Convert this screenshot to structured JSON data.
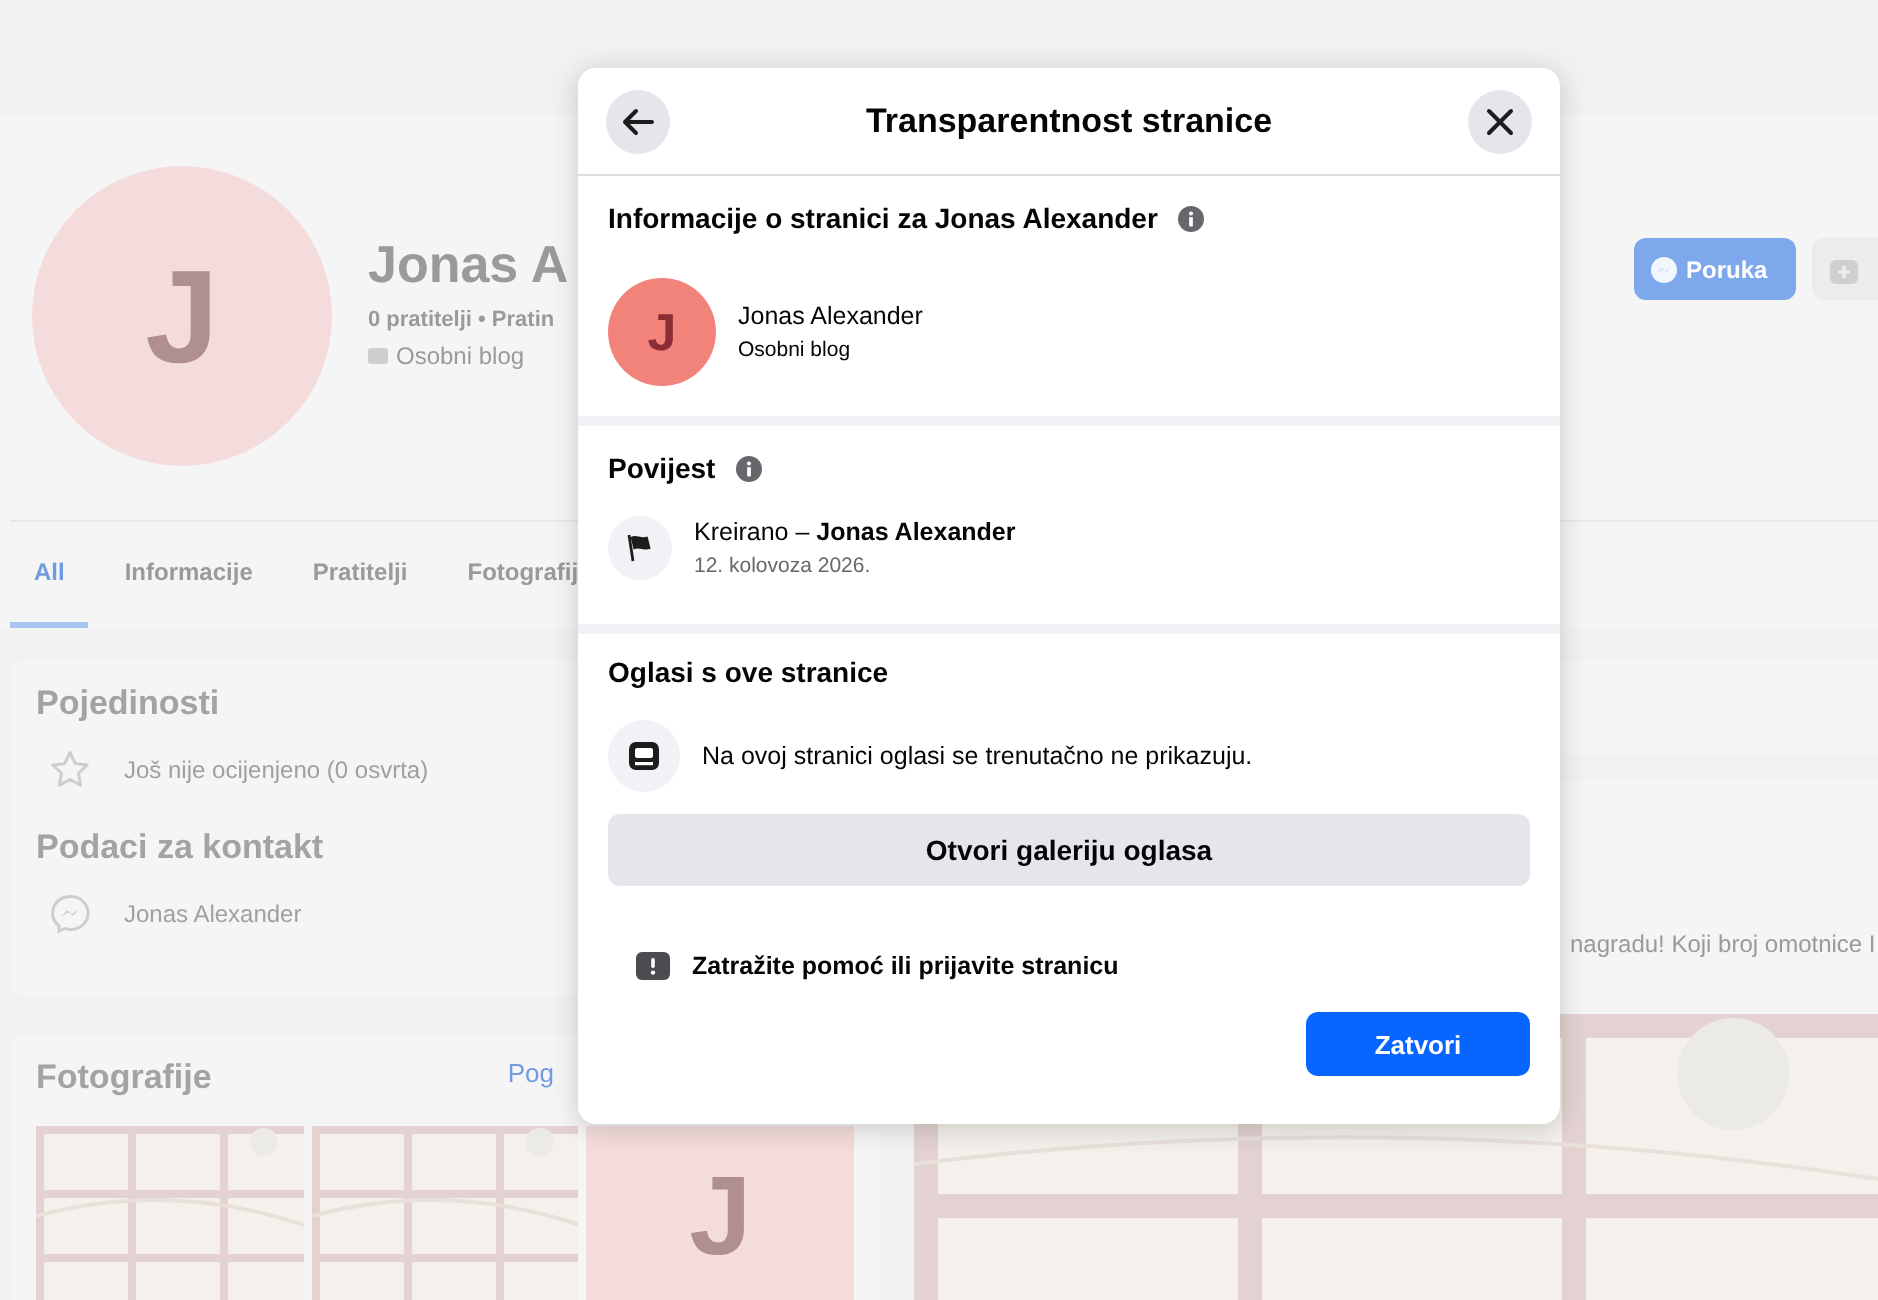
{
  "page": {
    "avatar_letter": "J",
    "name": "Jonas A",
    "stats": "0 pratitelji • Pratin",
    "category": "Osobni blog",
    "message_button": "Poruka"
  },
  "tabs": [
    {
      "label": "All",
      "selected": true
    },
    {
      "label": "Informacije",
      "selected": false
    },
    {
      "label": "Pratitelji",
      "selected": false
    },
    {
      "label": "Fotografij",
      "selected": false
    }
  ],
  "details": {
    "title": "Pojedinosti",
    "rating": "Još nije ocijenjeno (0 osvrta)",
    "contact_title": "Podaci za kontakt",
    "contact": "Jonas Alexander"
  },
  "photos": {
    "title": "Fotografije",
    "link": "Pog",
    "tile_letter": "J"
  },
  "post": {
    "text": "nagradu! Koji broj omotnice I"
  },
  "dialog": {
    "title": "Transparentnost stranice",
    "about": {
      "heading": "Informacije o stranici za Jonas Alexander",
      "avatar_letter": "J",
      "name": "Jonas Alexander",
      "category": "Osobni blog"
    },
    "history": {
      "heading": "Povijest",
      "entries": [
        {
          "text": "Kreirano – **Jonas Alexander**",
          "date": "12. kolovoza 2026."
        }
      ]
    },
    "ads": {
      "heading": "Oglasi s ove stranice",
      "note": "Na ovoj stranici oglasi se trenutačno ne prikazuju.",
      "button": "Otvori galeriju oglasa"
    },
    "report": "Zatražite pomoć ili prijavite stranicu",
    "close_button": "Zatvori"
  }
}
